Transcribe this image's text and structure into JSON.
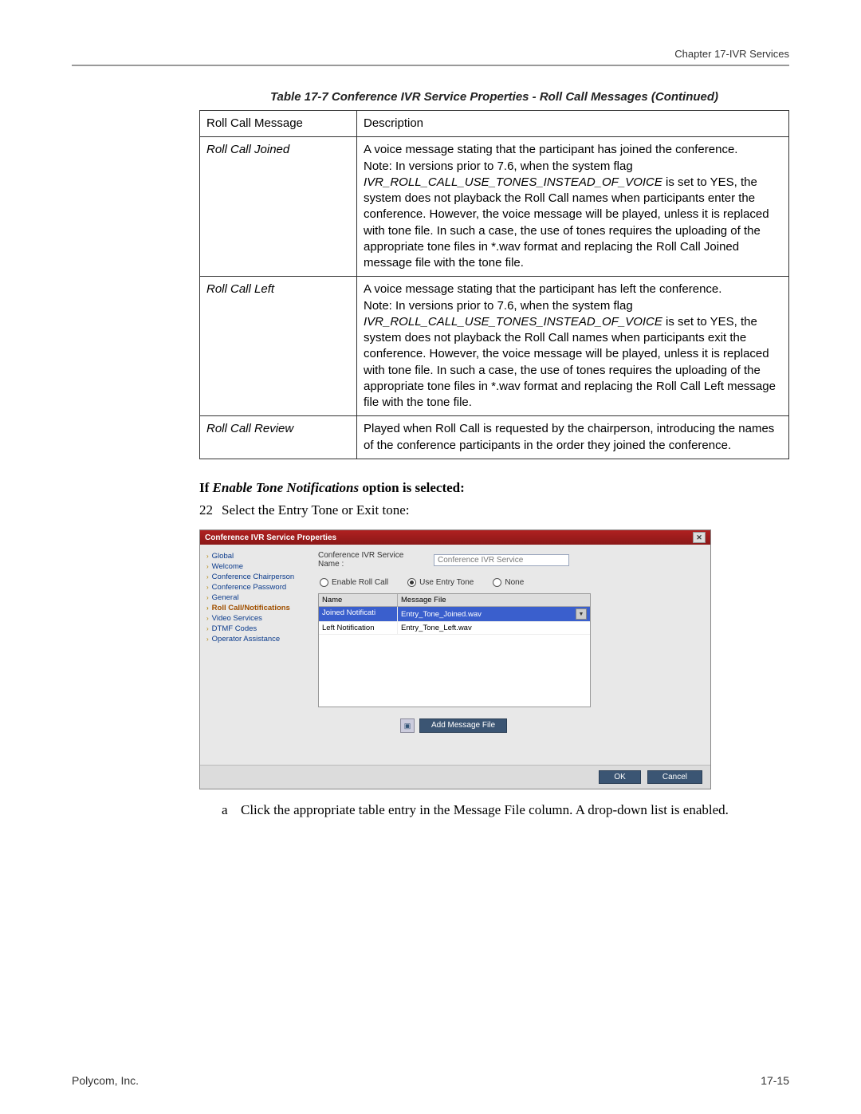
{
  "header": {
    "chapter_label": "Chapter 17-IVR Services"
  },
  "table": {
    "caption": "Table 17-7  Conference IVR Service Properties - Roll Call Messages (Continued)",
    "head_col1": "Roll Call Message",
    "head_col2": "Description",
    "rows": [
      {
        "name": "Roll Call Joined",
        "desc_pre": "A voice message stating that the participant has joined the conference.\nNote:  In versions prior to 7.6, when the system flag ",
        "flag": "IVR_ROLL_CALL_USE_TONES_INSTEAD_OF_VOICE",
        "desc_post": " is set to YES, the system does not playback the Roll Call names when participants enter the conference. However, the voice message will be played, unless it is replaced with tone file. In such a case, the use of tones requires the uploading of the appropriate tone files in *.wav format and replacing the Roll Call Joined message file with the tone file."
      },
      {
        "name": "Roll Call Left",
        "desc_pre": "A voice message stating that the participant has left the conference.\nNote:  In versions prior to 7.6, when the system flag ",
        "flag": "IVR_ROLL_CALL_USE_TONES_INSTEAD_OF_VOICE",
        "desc_post": " is set to YES, the system does not playback the Roll Call names when participants exit the conference. However, the voice message will be played, unless it is replaced with tone file. In such a case, the use of tones requires the uploading of the appropriate tone files in *.wav format and replacing the Roll Call Left message file with the tone file."
      },
      {
        "name": "Roll Call Review",
        "desc_plain": "Played when Roll Call is requested by the chairperson, introducing the names of the conference participants in the order they joined the conference."
      }
    ]
  },
  "body": {
    "cond_prefix": "If ",
    "cond_ital": "Enable Tone Notifications",
    "cond_suffix": " option is selected:",
    "step_num": "22",
    "step_text": "Select the Entry Tone or Exit tone:",
    "sub_marker": "a",
    "sub_pre": "Click the appropriate table entry in the ",
    "sub_ital": "Message File",
    "sub_post": " column. A drop-down list is enabled."
  },
  "dialog": {
    "title": "Conference IVR Service Properties",
    "nav": [
      "Global",
      "Welcome",
      "Conference Chairperson",
      "Conference Password",
      "General",
      "Roll Call/Notifications",
      "Video Services",
      "DTMF Codes",
      "Operator Assistance"
    ],
    "selected_nav": "Roll Call/Notifications",
    "svc_label": "Conference IVR Service Name :",
    "svc_value": "Conference IVR Service",
    "radios": {
      "r1": "Enable Roll Call",
      "r2": "Use Entry Tone",
      "r3": "None"
    },
    "table_head": {
      "c1": "Name",
      "c2": "Message File"
    },
    "table_rows": [
      {
        "c1": "Joined Notificati",
        "c2": "Entry_Tone_Joined.wav",
        "sel": true,
        "dd": true
      },
      {
        "c1": "Left Notification",
        "c2": "Entry_Tone_Left.wav",
        "sel": false,
        "dd": false
      }
    ],
    "add_btn": "Add Message File",
    "ok": "OK",
    "cancel": "Cancel"
  },
  "footer": {
    "left": "Polycom, Inc.",
    "right": "17-15"
  }
}
